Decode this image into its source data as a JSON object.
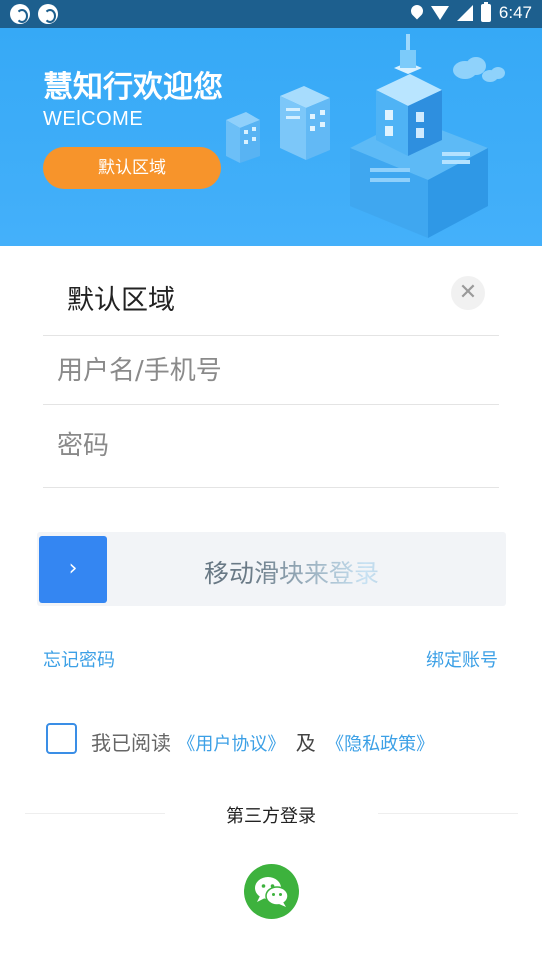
{
  "status_bar": {
    "time": "6:47",
    "icons": [
      "app-notification-icon",
      "app-notification-icon",
      "location-icon",
      "wifi-icon",
      "signal-icon",
      "battery-icon"
    ]
  },
  "banner": {
    "title": "慧知行欢迎您",
    "subtitle": "WElCOME",
    "region_button": "默认区域"
  },
  "form": {
    "region_value": "默认区域",
    "clear_icon": "✕",
    "username_placeholder": "用户名/手机号",
    "password_placeholder": "密码"
  },
  "slider": {
    "handle_icon": "›",
    "label": "移动滑块来登录"
  },
  "links": {
    "forgot_password": "忘记密码",
    "bind_account": "绑定账号"
  },
  "agreement": {
    "checked": false,
    "prefix": "我已阅读",
    "user_agreement": "《用户协议》",
    "and": "及",
    "privacy_policy": "《隐私政策》"
  },
  "third_party": {
    "label": "第三方登录",
    "providers": [
      "wechat-icon"
    ]
  },
  "colors": {
    "status_bar": "#1d5f8e",
    "banner": "#3aabf7",
    "accent_orange": "#f7942b",
    "slider_handle": "#3486f2",
    "link": "#3ca0e6",
    "wechat": "#3db23d"
  }
}
